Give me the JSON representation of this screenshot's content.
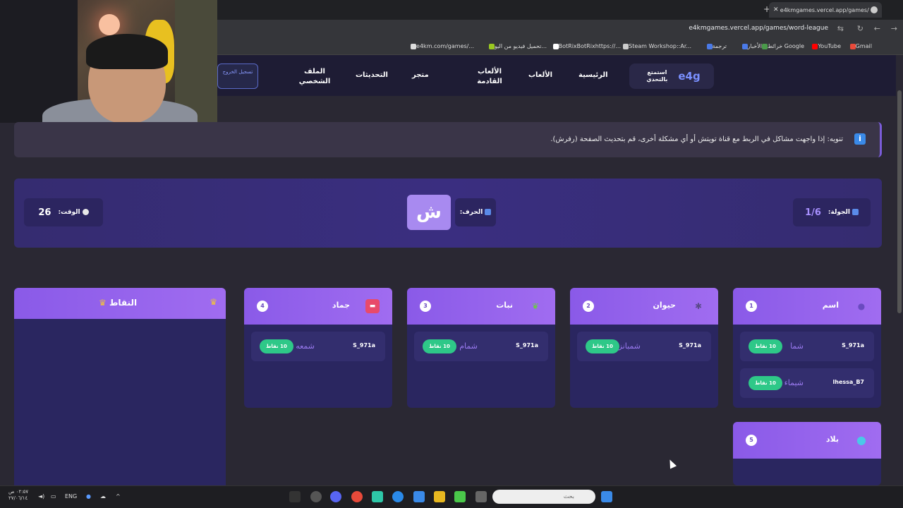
{
  "browser": {
    "tab_title": "e4kmgames.vercel.app/games/",
    "url": "e4kmgames.vercel.app/games/word-league",
    "bookmarks": [
      "Gmail",
      "YouTube",
      "خرائط Google",
      "الأخبار",
      "ترجمة",
      "Steam Workshop::Ar...",
      "BotRixBotRixhttps://...",
      "تحميل فيديو من اليو...",
      "e4km.com/games/..."
    ]
  },
  "header": {
    "logo": "e4g",
    "tagline": "استمتع بالتحدي",
    "nav": [
      "الرئيسية",
      "الألعاب",
      "الألعاب القادمة",
      "متجر",
      "التحديثات",
      "الملف الشخصي"
    ],
    "logout": "تسجيل الخروج"
  },
  "notice": {
    "icon": "i",
    "text": "تنويه: إذا واجهت مشاكل في الربط مع قناة تويتش أو أي مشكلة أخرى، قم بتحديث الصفحة (رفرش)."
  },
  "game": {
    "round_label": "الجولة:",
    "round_value": "1/6",
    "letter_label": "الحرف:",
    "letter": "ش",
    "timer_label": "الوقت:",
    "timer_value": "26"
  },
  "categories": [
    {
      "title": "اسم",
      "number": "1",
      "icon": "person-icon",
      "entries": [
        {
          "user": "S_971a",
          "word": "شما",
          "points": "10 نقاط"
        },
        {
          "user": "lhessa_B7",
          "word": "شيماء",
          "points": "10 نقاط"
        }
      ]
    },
    {
      "title": "حيوان",
      "number": "2",
      "icon": "paw-icon",
      "entries": [
        {
          "user": "S_971a",
          "word": "شمبانزي",
          "points": "10 نقاط"
        }
      ]
    },
    {
      "title": "نبات",
      "number": "3",
      "icon": "leaf-icon",
      "entries": [
        {
          "user": "S_971a",
          "word": "شمام",
          "points": "10 نقاط"
        }
      ]
    },
    {
      "title": "جماد",
      "number": "4",
      "icon": "object-icon",
      "entries": [
        {
          "user": "S_971a",
          "word": "شمعه",
          "points": "10 نقاط"
        }
      ]
    },
    {
      "title": "بلاد",
      "number": "5",
      "icon": "globe-icon",
      "entries": []
    }
  ],
  "scoreboard": {
    "title": "النقاط"
  },
  "taskbar": {
    "search_placeholder": "بحث",
    "lang": "ENG",
    "time": "٠٢:٥٧ ص",
    "date": "٢٧/٠٦/١٤"
  }
}
